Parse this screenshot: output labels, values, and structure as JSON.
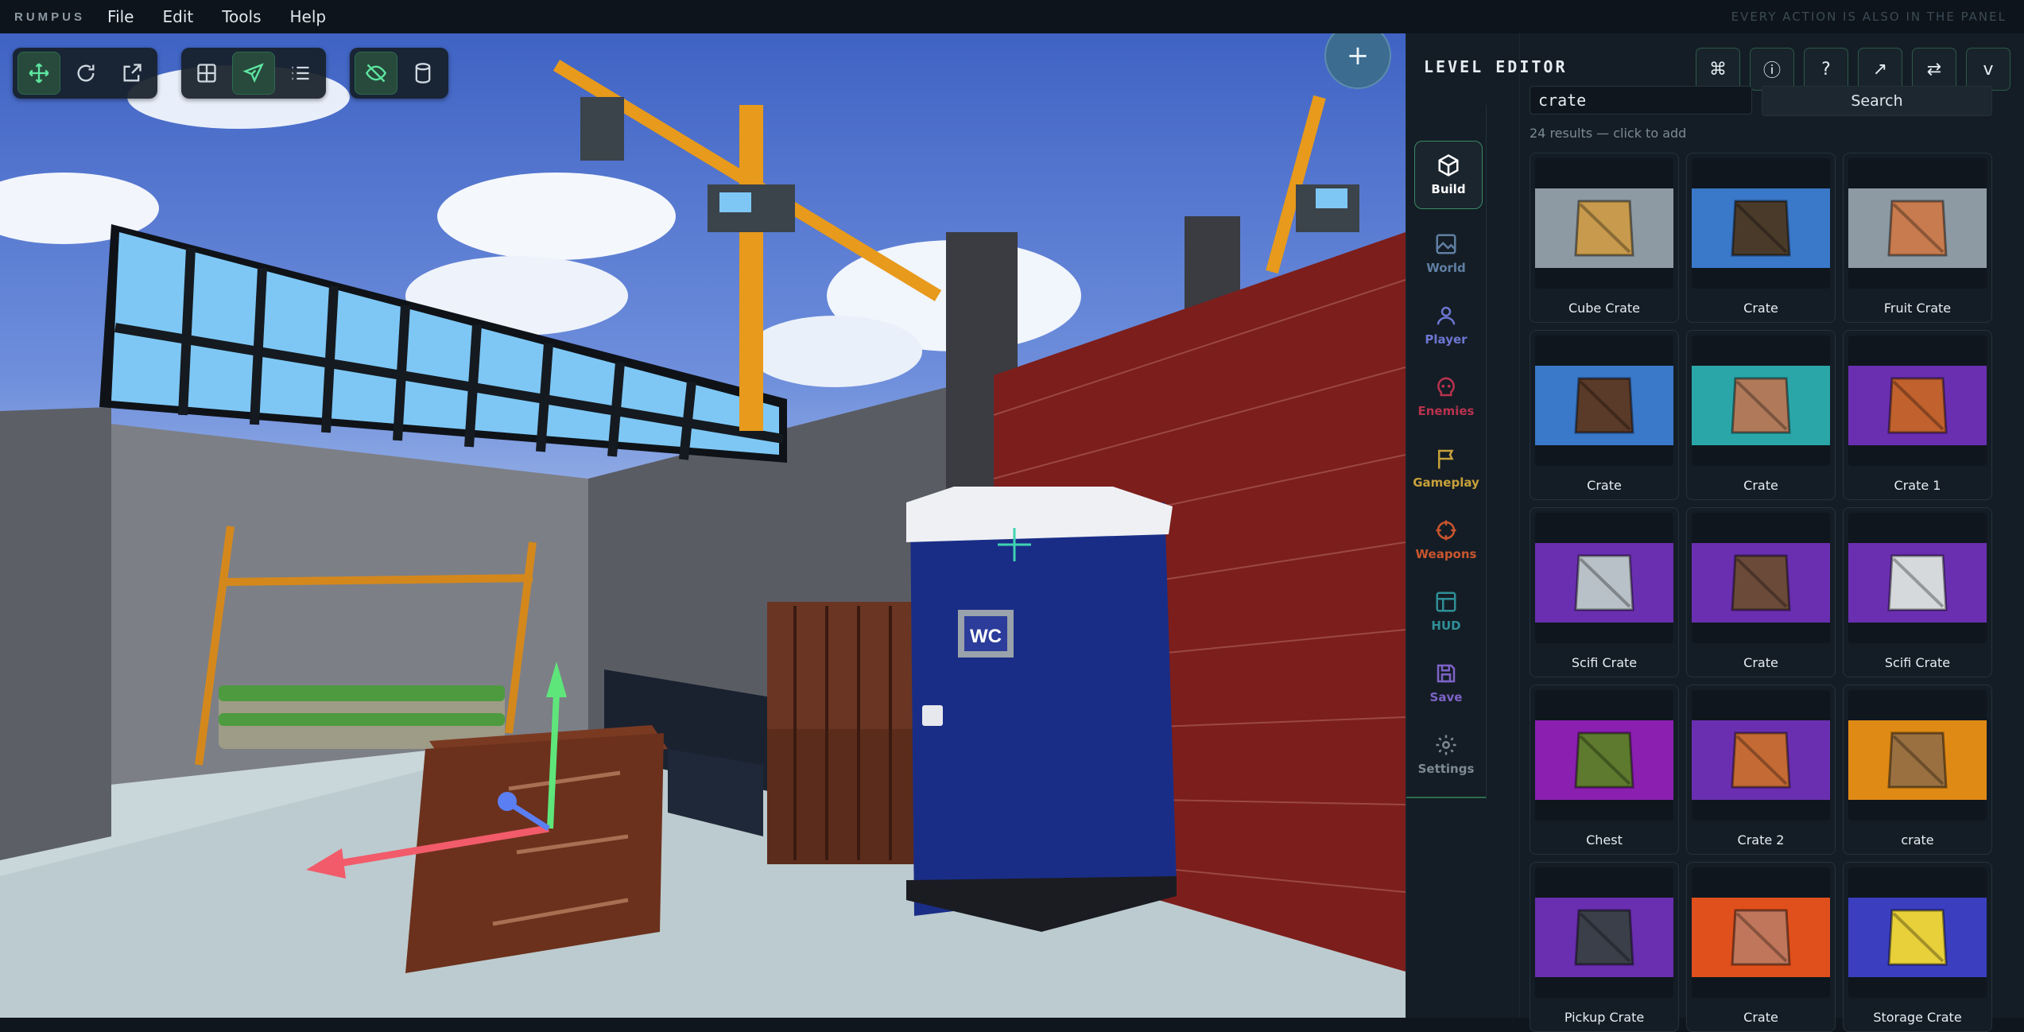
{
  "app": {
    "brand": "RUMPUS",
    "hint": "EVERY ACTION IS ALSO IN THE PANEL"
  },
  "menu": [
    "File",
    "Edit",
    "Tools",
    "Help"
  ],
  "viewport": {
    "add_label": "+",
    "sign_text": "WC"
  },
  "panel": {
    "title": "LEVEL EDITOR",
    "header_buttons": [
      "⌘",
      "ⓘ",
      "?",
      "↗",
      "⇄",
      "v"
    ],
    "rail": [
      {
        "label": "Build",
        "icon": "cube-icon",
        "color": "#ffffff"
      },
      {
        "label": "World",
        "icon": "image-icon",
        "color": "#5f7fa3"
      },
      {
        "label": "Player",
        "icon": "user-icon",
        "color": "#6d76d1"
      },
      {
        "label": "Enemies",
        "icon": "skull-icon",
        "color": "#b8324e"
      },
      {
        "label": "Gameplay",
        "icon": "flag-icon",
        "color": "#c7a13a"
      },
      {
        "label": "Weapons",
        "icon": "crosshair-icon",
        "color": "#c9552e"
      },
      {
        "label": "HUD",
        "icon": "layout-icon",
        "color": "#2f8f97"
      },
      {
        "label": "Save",
        "icon": "save-icon",
        "color": "#7d63c7"
      },
      {
        "label": "Settings",
        "icon": "gear-icon",
        "color": "#7d8a94"
      }
    ],
    "search": {
      "value": "crate",
      "button": "Search"
    },
    "result_count": "24 results — click to add",
    "items": [
      {
        "label": "Cube Crate",
        "bg": "#8d9aa3",
        "box": "#c79a4d"
      },
      {
        "label": "Crate",
        "bg": "#3a78c9",
        "box": "#4a3a2a"
      },
      {
        "label": "Fruit Crate",
        "bg": "#8d9aa3",
        "box": "#c77b4e"
      },
      {
        "label": "Crate",
        "bg": "#3a78c9",
        "box": "#5a3a28"
      },
      {
        "label": "Crate",
        "bg": "#2aa6a9",
        "box": "#b07a5a"
      },
      {
        "label": "Crate 1",
        "bg": "#6a2fb0",
        "box": "#c0612e"
      },
      {
        "label": "Scifi Crate",
        "bg": "#6a2fb0",
        "box": "#b9c1c8"
      },
      {
        "label": "Crate",
        "bg": "#6a2fb0",
        "box": "#6b4a3a"
      },
      {
        "label": "Scifi Crate",
        "bg": "#6a2fb0",
        "box": "#d6d9dc"
      },
      {
        "label": "Chest",
        "bg": "#8a1fb0",
        "box": "#5d7a2e"
      },
      {
        "label": "Crate 2",
        "bg": "#6a2fb0",
        "box": "#c46a35"
      },
      {
        "label": "crate",
        "bg": "#e08a16",
        "box": "#9a7040"
      },
      {
        "label": "Pickup Crate",
        "bg": "#6a2fb0",
        "box": "#3b3f4a"
      },
      {
        "label": "Crate",
        "bg": "#e0501d",
        "box": "#c0765a"
      },
      {
        "label": "Storage Crate",
        "bg": "#3b3fbf",
        "box": "#e8d03a"
      }
    ]
  }
}
